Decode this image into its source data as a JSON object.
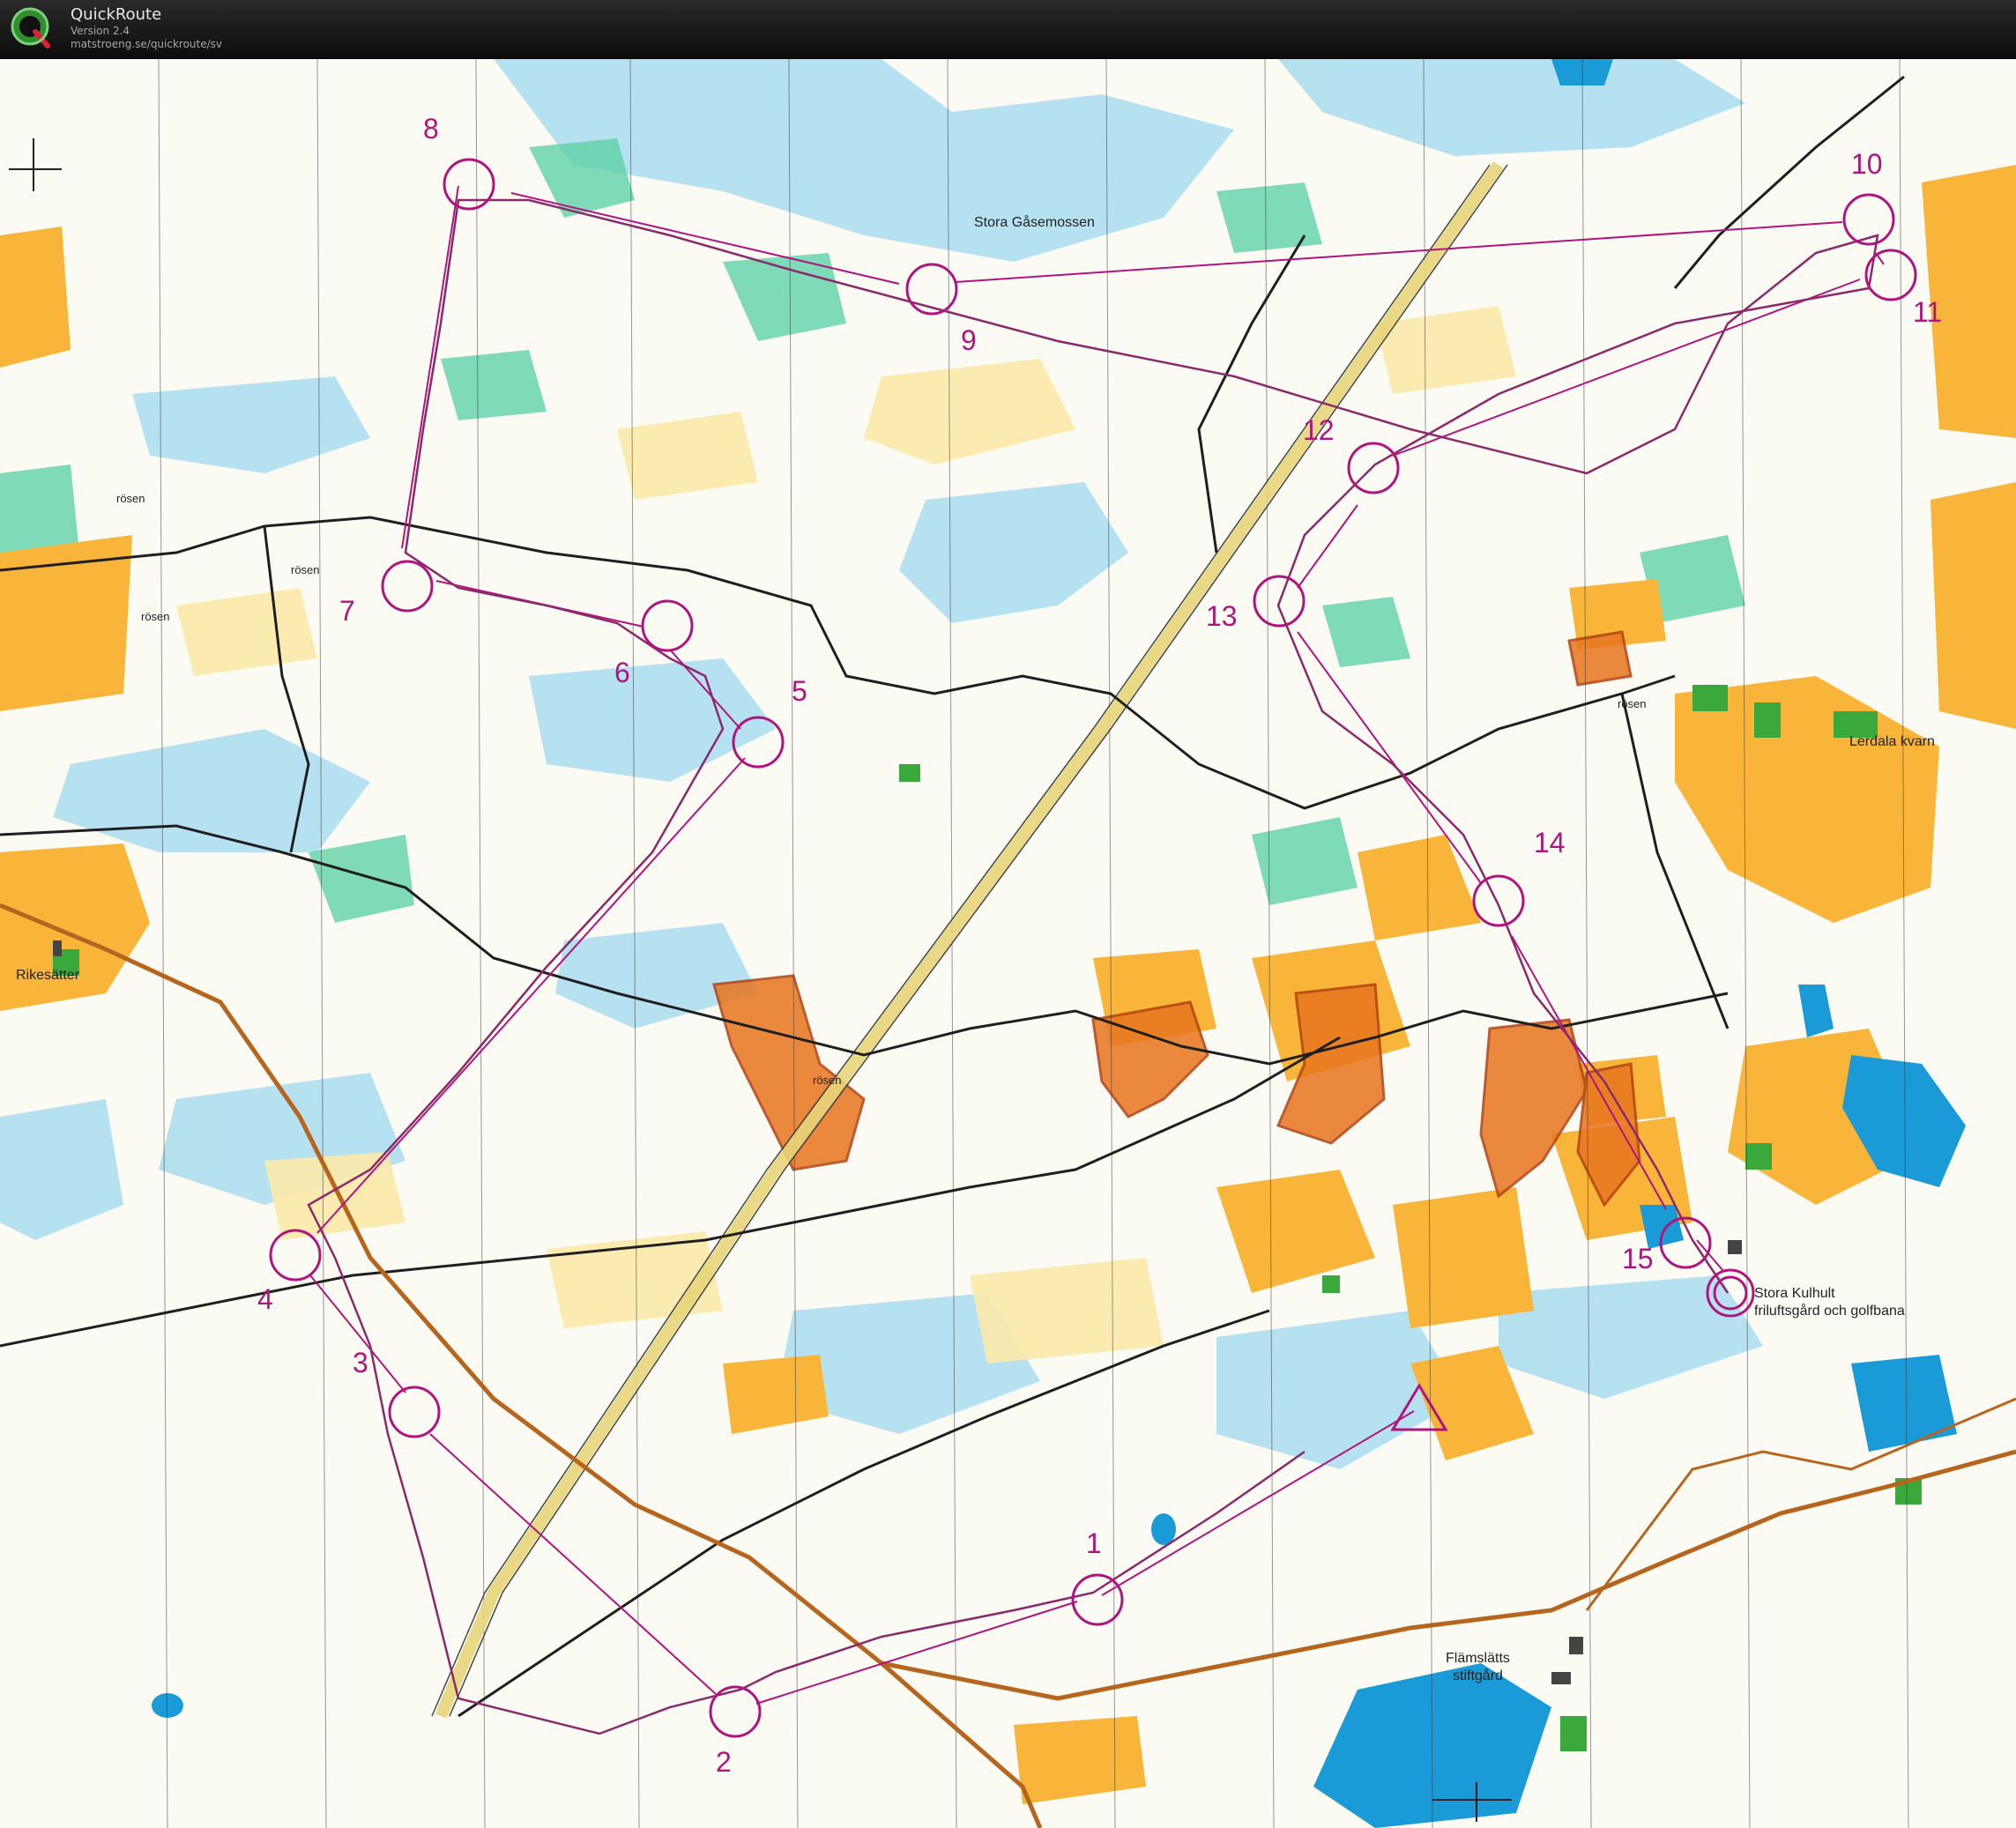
{
  "app": {
    "name": "QuickRoute",
    "version": "Version 2.4",
    "url": "matstroeng.se/quickroute/sv"
  },
  "map": {
    "place_names": {
      "stora_gasemossen": "Stora Gåsemossen",
      "lerdala_kvarn": "Lerdala kvarn",
      "rikesatter": "Rikesätter",
      "stora_kulhult_line1": "Stora Kulhult",
      "stora_kulhult_line2": "friluftsgård och golfbana",
      "flamslatts_line1": "Flämslätts",
      "flamslatts_line2": "stiftgård",
      "rosen": "rösen"
    },
    "controls": [
      "1",
      "2",
      "3",
      "4",
      "5",
      "6",
      "7",
      "8",
      "9",
      "10",
      "11",
      "12",
      "13",
      "14",
      "15"
    ],
    "colors": {
      "course": "#b0157f",
      "route": "#8a2a6a",
      "marsh": "#8fd3e6",
      "water": "#1a9ad6",
      "open": "#f7b733",
      "rough_open": "#fbe6a2",
      "green": "#46c79a",
      "forbidden": "#e06a1a",
      "road": "#222222",
      "main_road": "#b5651d"
    }
  }
}
